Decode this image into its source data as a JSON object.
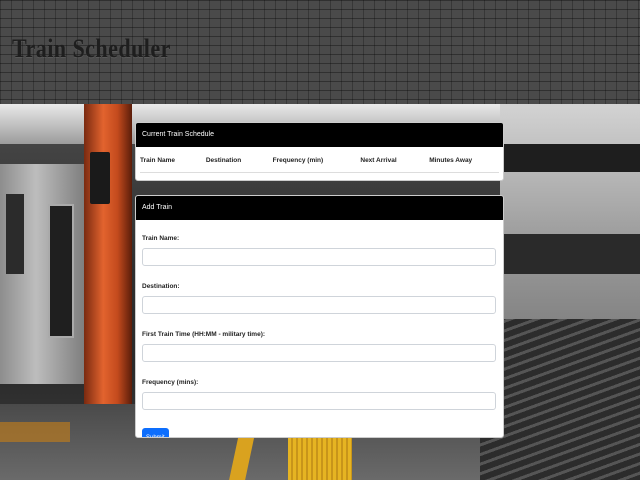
{
  "header": {
    "title": "Train Scheduler"
  },
  "schedule": {
    "header": "Current Train Schedule",
    "columns": [
      "Train Name",
      "Destination",
      "Frequency (min)",
      "Next Arrival",
      "Minutes Away"
    ]
  },
  "add_train": {
    "header": "Add Train",
    "fields": [
      {
        "label": "Train Name:",
        "value": "",
        "placeholder": ""
      },
      {
        "label": "Destination:",
        "value": "",
        "placeholder": ""
      },
      {
        "label": "First Train Time (HH:MM - military time):",
        "value": "",
        "placeholder": ""
      },
      {
        "label": "Frequency (mins):",
        "value": "",
        "placeholder": ""
      }
    ],
    "submit_label": "Submit"
  },
  "colors": {
    "card_header_bg": "#000000",
    "button_bg": "#0d6efd",
    "pillar": "#e2632e"
  }
}
